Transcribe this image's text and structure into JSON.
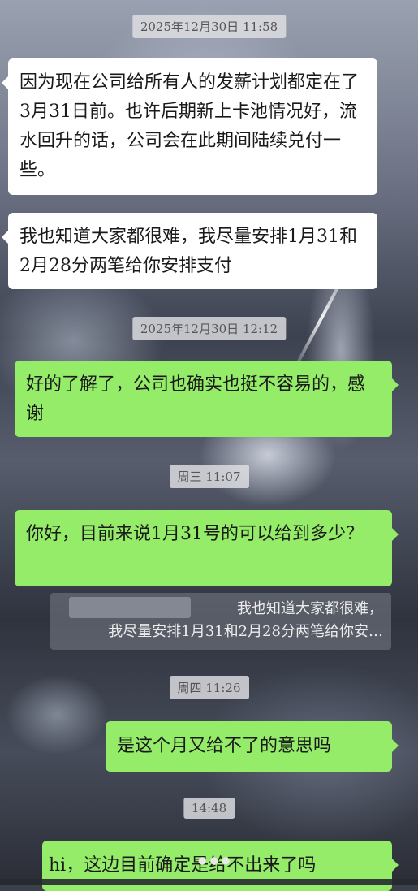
{
  "chat": {
    "messages": [
      {
        "type": "timestamp",
        "text": "2025年12月30日 11:58"
      },
      {
        "type": "incoming",
        "text": "因为现在公司给所有人的发薪计划都定在了3月31日前。也许后期新上卡池情况好，流水回升的话，公司会在此期间陆续兑付一些。"
      },
      {
        "type": "incoming",
        "text": "我也知道大家都很难，我尽量安排1月31和2月28分两笔给你安排支付"
      },
      {
        "type": "timestamp",
        "text": "2025年12月30日 12:12"
      },
      {
        "type": "outgoing",
        "text": "好的了解了，公司也确实也挺不容易的，感谢"
      },
      {
        "type": "timestamp",
        "text": "周三 11:07"
      },
      {
        "type": "outgoing",
        "text": "你好，目前来说1月31号的可以给到多少？"
      },
      {
        "type": "quote",
        "line1": "我也知道大家都很难，",
        "line2": "我尽量安排1月31和2月28分两笔给你安…"
      },
      {
        "type": "timestamp",
        "text": "周四 11:26"
      },
      {
        "type": "outgoing",
        "text": "是这个月又给不了的意思吗"
      },
      {
        "type": "timestamp",
        "text": "14:48"
      },
      {
        "type": "incoming",
        "text": "hi，这边目前确定是给不出来了吗"
      }
    ],
    "loading_indicator": "●●●"
  },
  "colors": {
    "incoming_bubble": "#ffffff",
    "outgoing_bubble": "#95ec69",
    "timestamp_bg": "#e1e1e4"
  }
}
